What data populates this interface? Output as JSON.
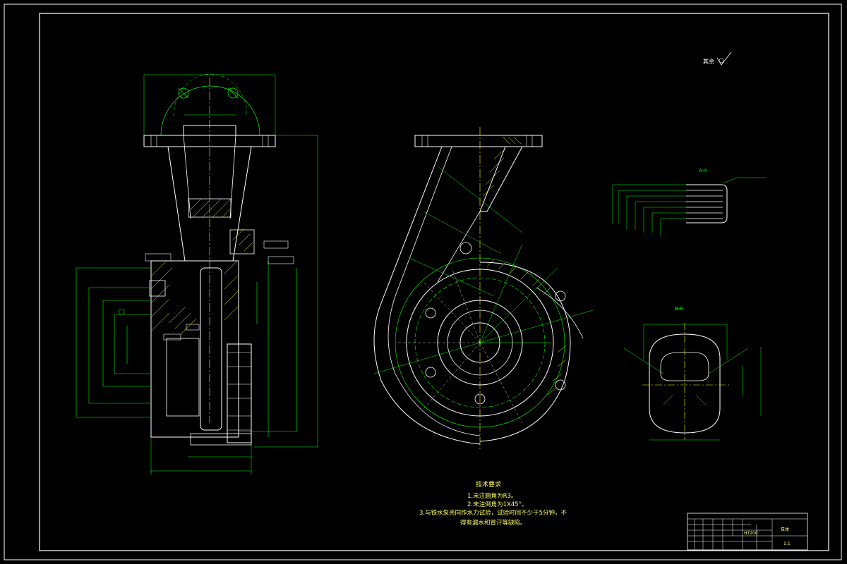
{
  "drawing": {
    "title": "",
    "roughness_note": "其余",
    "roughness_value": "",
    "colors": {
      "background": "#000000",
      "outline": "#ffffff",
      "dimension": "#00ff00",
      "center_line": "#ffff00",
      "hatch": "#ffff00",
      "notes": "#ffff66"
    }
  },
  "technical_requirements": {
    "title": "技术要求",
    "items": [
      "1.未注圆角为R3。",
      "2.未注倒角为1X45°。",
      "3.与铁水泵壳同作水力试验，试验时间不少于5分钟，不",
      "得有漏水和冒汗等缺陷。"
    ]
  },
  "title_block": {
    "part_name": "泵体",
    "drawing_code": "",
    "material": "HT200",
    "scale": "1:1"
  },
  "views": {
    "section_view": {
      "label": ""
    },
    "front_view": {
      "label": ""
    },
    "detail_a": {
      "label": "A-A"
    },
    "section_b": {
      "label": "B-B"
    }
  }
}
